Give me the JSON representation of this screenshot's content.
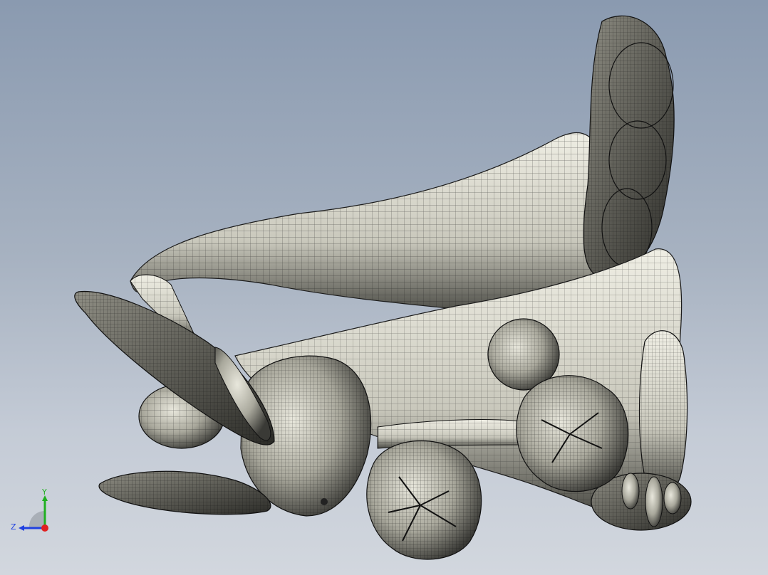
{
  "viewport": {
    "background": [
      "#8a9ab0",
      "#c4cbd6",
      "#d2d7de"
    ],
    "model_fill": "#d9d8cc",
    "model_shade": "#3a3a36",
    "mesh_color": "#1a1a1a"
  },
  "triad": {
    "x_color": "#e02020",
    "y_color": "#20b020",
    "z_color": "#2040e0",
    "y_label": "Y",
    "z_label": "Z"
  }
}
